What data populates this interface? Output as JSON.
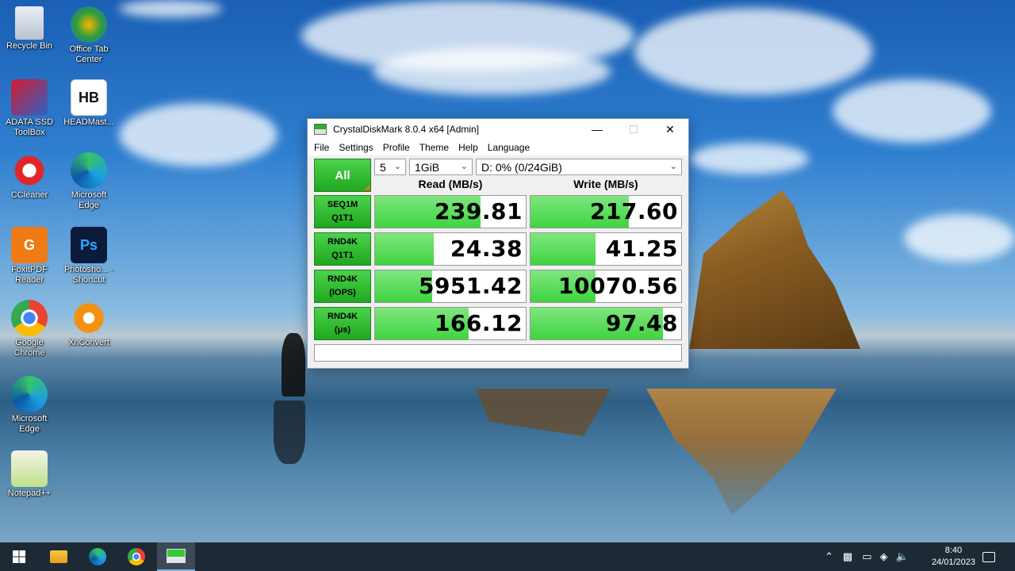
{
  "desktop": {
    "icons": [
      {
        "label": "Recycle Bin",
        "icon": "recycle-bin-icon"
      },
      {
        "label": "Office Tab Center",
        "icon": "office-tab-icon"
      },
      {
        "label": "ADATA SSD ToolBox",
        "icon": "adata-icon"
      },
      {
        "label": "HEADMast...",
        "icon": "headmaster-icon",
        "glyph": "HB"
      },
      {
        "label": "CCleaner",
        "icon": "ccleaner-icon"
      },
      {
        "label": "Microsoft Edge",
        "icon": "edge-icon"
      },
      {
        "label": "FoxitPDF Reader",
        "icon": "foxit-icon",
        "glyph": "G"
      },
      {
        "label": "Photosho... - Shortcut",
        "icon": "photoshop-icon",
        "glyph": "Ps"
      },
      {
        "label": "Google Chrome",
        "icon": "chrome-icon"
      },
      {
        "label": "XnConvert",
        "icon": "xnconvert-icon"
      },
      {
        "label": "Microsoft Edge",
        "icon": "edge-icon"
      },
      {
        "label": "Notepad++",
        "icon": "notepadpp-icon"
      }
    ]
  },
  "window": {
    "title": "CrystalDiskMark 8.0.4 x64 [Admin]",
    "menu": [
      "File",
      "Settings",
      "Profile",
      "Theme",
      "Help",
      "Language"
    ],
    "all_label": "All",
    "count": "5",
    "size": "1GiB",
    "drive": "D: 0% (0/24GiB)",
    "read_header": "Read (MB/s)",
    "write_header": "Write (MB/s)",
    "rows": [
      {
        "line1": "SEQ1M",
        "line2": "Q1T1",
        "read": "239.81",
        "write": "217.60",
        "read_fill": 0.7,
        "write_fill": 0.65
      },
      {
        "line1": "RND4K",
        "line2": "Q1T1",
        "read": "24.38",
        "write": "41.25",
        "read_fill": 0.39,
        "write_fill": 0.43
      },
      {
        "line1": "RND4K",
        "line2": "(IOPS)",
        "read": "5951.42",
        "write": "10070.56",
        "read_fill": 0.38,
        "write_fill": 0.43
      },
      {
        "line1": "RND4K",
        "line2": "(μs)",
        "read": "166.12",
        "write": "97.48",
        "read_fill": 0.62,
        "write_fill": 0.88
      }
    ],
    "colors": {
      "green": "#1fa81f",
      "bar": "#3fd43f"
    }
  },
  "taskbar": {
    "time": "8:40",
    "date": "24/01/2023",
    "pinned": [
      "start-icon",
      "file-explorer-icon",
      "edge-icon",
      "chrome-icon",
      "crystaldiskmark-icon"
    ]
  }
}
